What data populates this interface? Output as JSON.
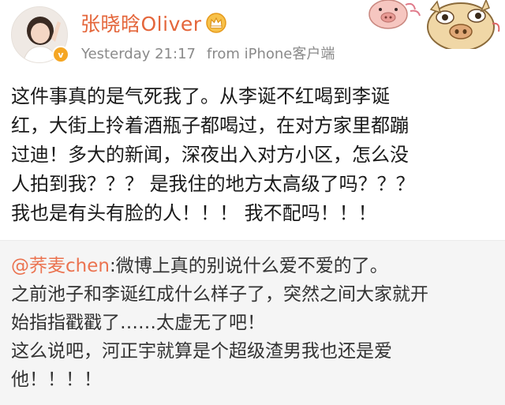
{
  "post": {
    "author": {
      "name": "张晓晗Oliver",
      "verified_badge": "v",
      "colors": {
        "name": "#e4663b",
        "verified": "#f5a623"
      }
    },
    "meta": {
      "time": "Yesterday 21:17",
      "source": "from iPhone客户端"
    },
    "body_lines": [
      "这件事真的是气死我了。从李诞不红喝到李诞",
      "红，大街上拎着酒瓶子都喝过，在对方家里都蹦",
      "过迪！多大的新闻，深夜出入对方小区，怎么没",
      "人拍到我？？？ 是我住的地方太高级了吗？？？",
      "我也是有头有脸的人！！！ 我不配吗！！！"
    ]
  },
  "repost": {
    "mention": "@荞麦chen",
    "first_line_rest": ":微博上真的别说什么爱不爱的了。",
    "lines": [
      "之前池子和李诞红成什么样子了，突然之间大家就开",
      "始指指戳戳了……太虚无了吧！",
      "这么说吧，河正宇就算是个超级渣男我也还是爱",
      "他！！！！"
    ],
    "colors": {
      "mention": "#eb7350",
      "background": "#f5f5f5"
    }
  },
  "icons": {
    "crown": "crown-icon",
    "sticker": "cartoon-pig-sticker",
    "avatar": "avatar"
  }
}
